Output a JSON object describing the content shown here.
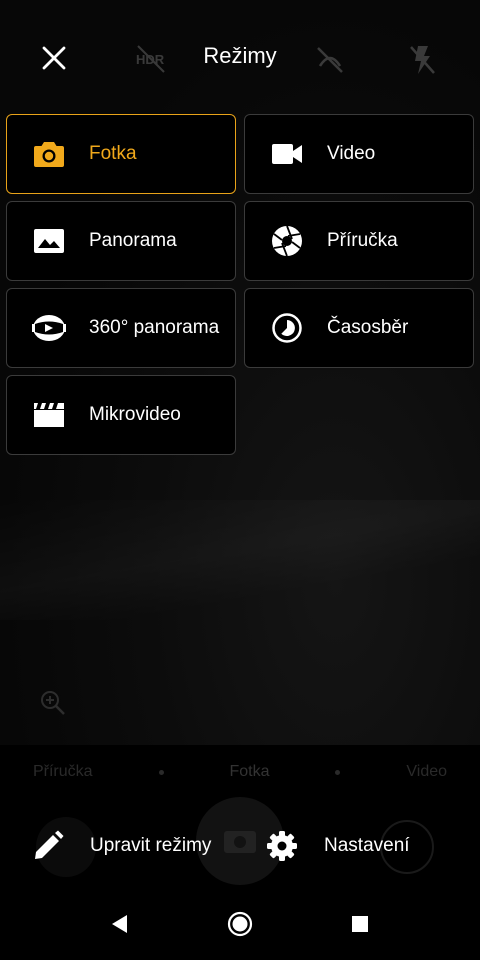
{
  "header": {
    "title": "Režimy"
  },
  "modes": [
    {
      "label": "Fotka",
      "icon": "camera-icon",
      "active": true
    },
    {
      "label": "Video",
      "icon": "videocam-icon",
      "active": false
    },
    {
      "label": "Panorama",
      "icon": "landscape-icon",
      "active": false
    },
    {
      "label": "Příručka",
      "icon": "aperture-icon",
      "active": false
    },
    {
      "label": "360° panorama",
      "icon": "panorama-360-icon",
      "active": false
    },
    {
      "label": "Časosběr",
      "icon": "timelapse-icon",
      "active": false
    },
    {
      "label": "Mikrovideo",
      "icon": "movie-clapper-icon",
      "active": false
    }
  ],
  "actions": {
    "edit_label": "Upravit režimy",
    "settings_label": "Nastavení"
  },
  "background": {
    "mode_strip": [
      "Příručka",
      "Fotka",
      "Video"
    ]
  },
  "colors": {
    "accent": "#f1a91b",
    "border": "#3b3b3b",
    "background": "#000000"
  }
}
